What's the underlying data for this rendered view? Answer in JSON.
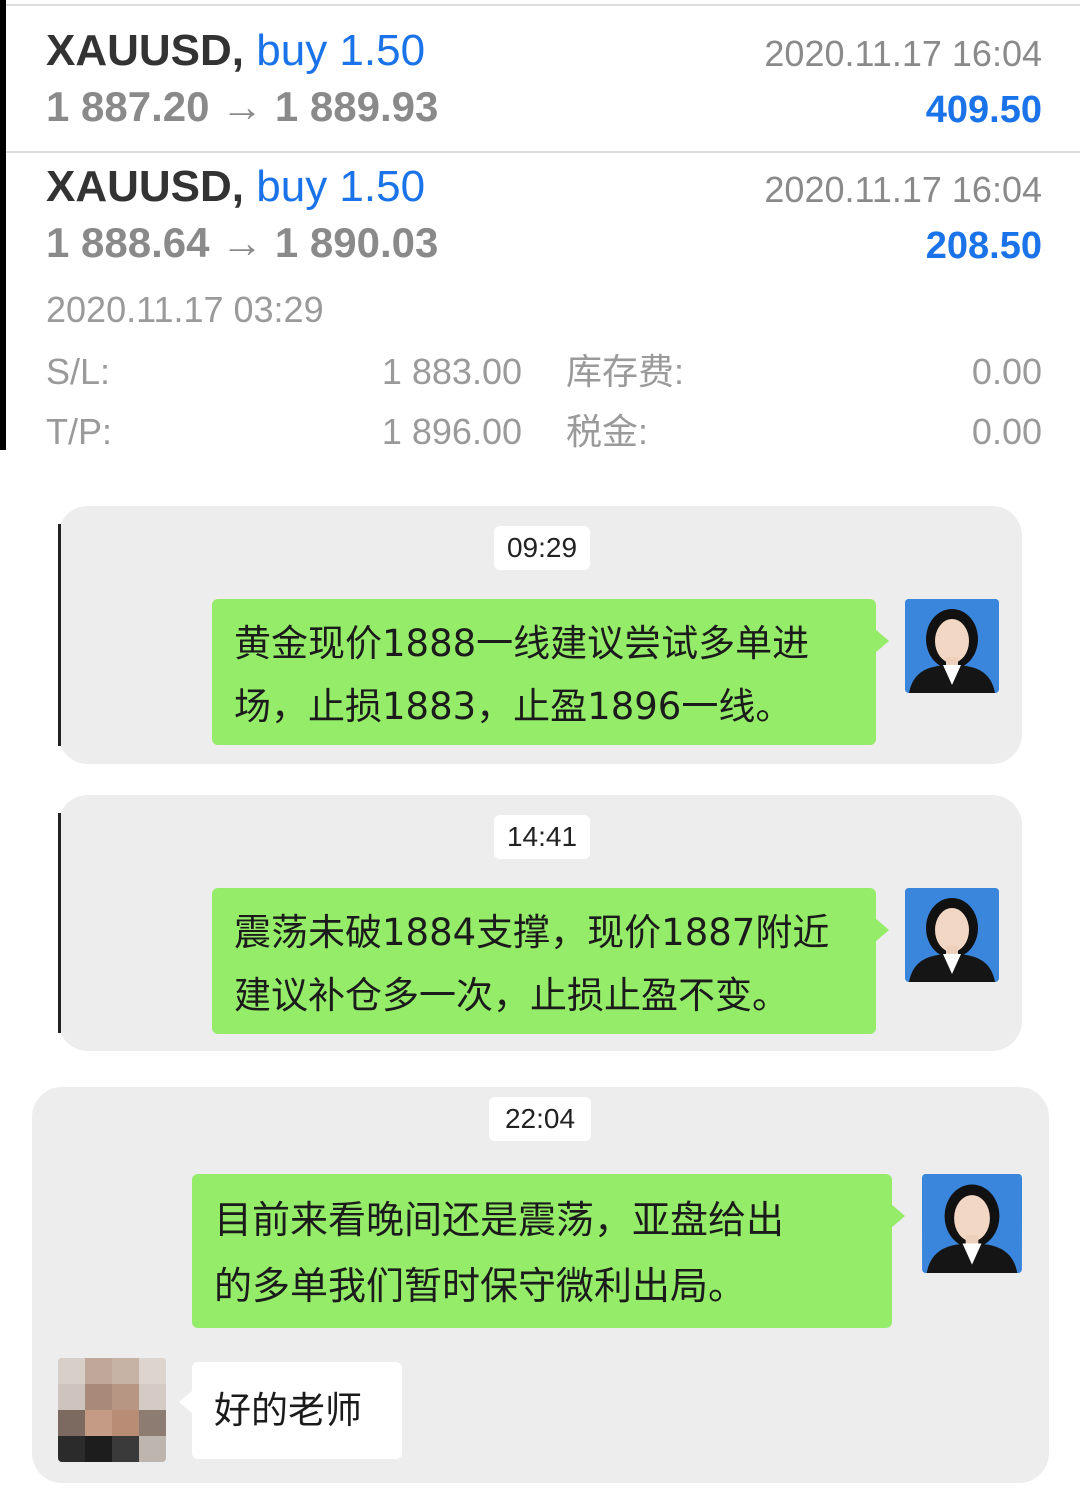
{
  "trades": [
    {
      "symbol": "XAUUSD,",
      "direction": "buy 1.50",
      "open_price": "1 887.20",
      "arrow": "→",
      "close_price": "1 889.93",
      "close_time": "2020.11.17 16:04",
      "profit": "409.50"
    },
    {
      "symbol": "XAUUSD,",
      "direction": "buy 1.50",
      "open_price": "1 888.64",
      "arrow": "→",
      "close_price": "1 890.03",
      "close_time": "2020.11.17 16:04",
      "profit": "208.50",
      "open_time": "2020.11.17 03:29",
      "sl_label": "S/L:",
      "sl_value": "1 883.00",
      "tp_label": "T/P:",
      "tp_value": "1 896.00",
      "swap_label": "库存费:",
      "swap_value": "0.00",
      "tax_label": "税金:",
      "tax_value": "0.00"
    }
  ],
  "chats": [
    {
      "time": "09:29",
      "message_lines": [
        "黄金现价1888一线建议尝试多单进",
        "场，止损1883，止盈1896一线。"
      ]
    },
    {
      "time": "14:41",
      "message_lines": [
        "震荡未破1884支撑，现价1887附近",
        "建议补仓多一次，止损止盈不变。"
      ]
    },
    {
      "time": "22:04",
      "message_lines": [
        "目前来看晚间还是震荡，亚盘给出",
        "的多单我们暂时保守微利出局。"
      ],
      "reply": "好的老师"
    }
  ],
  "colors": {
    "accent_blue": "#1a73e8",
    "bubble_green": "#95ec69",
    "card_gray": "#ededed",
    "avatar_bg": "#2e7bd6"
  },
  "icons": {
    "sender_avatar": "female-profile-photo",
    "user_avatar": "mosaic-blurred-avatar"
  }
}
